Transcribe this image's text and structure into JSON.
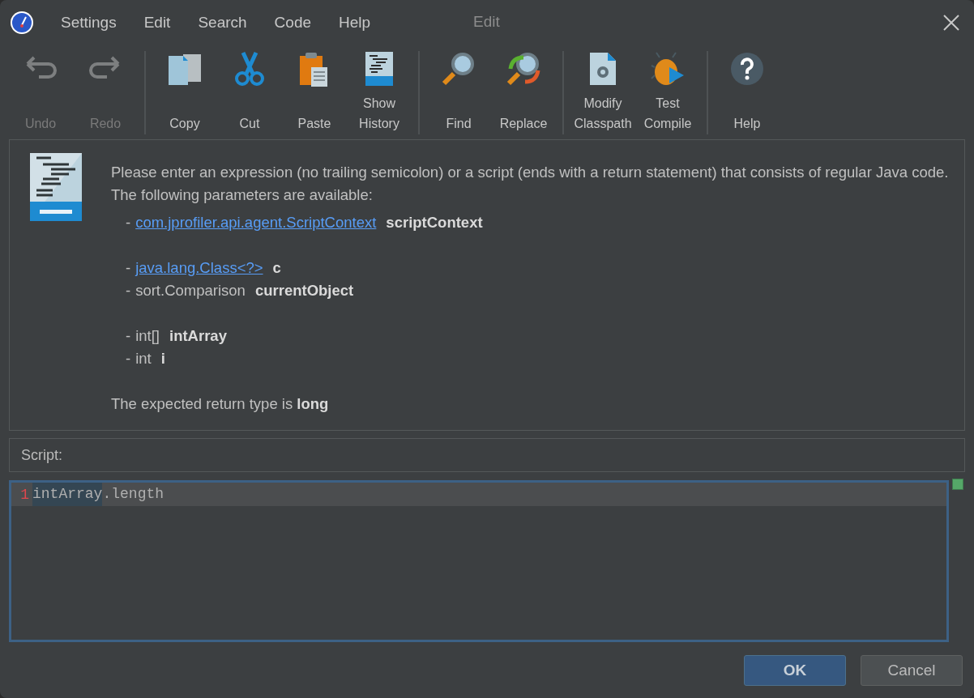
{
  "window": {
    "title": "Edit"
  },
  "menu": [
    "Settings",
    "Edit",
    "Search",
    "Code",
    "Help"
  ],
  "toolbar": [
    [
      {
        "kind": "undo",
        "lines": [
          "Undo"
        ],
        "disabled": true
      },
      {
        "kind": "redo",
        "lines": [
          "Redo"
        ],
        "disabled": true
      }
    ],
    [
      {
        "kind": "copy",
        "lines": [
          "Copy"
        ],
        "disabled": false
      },
      {
        "kind": "cut",
        "lines": [
          "Cut"
        ],
        "disabled": false
      },
      {
        "kind": "paste",
        "lines": [
          "Paste"
        ],
        "disabled": false
      },
      {
        "kind": "history",
        "lines": [
          "Show",
          "History"
        ],
        "disabled": false
      }
    ],
    [
      {
        "kind": "find",
        "lines": [
          "Find"
        ],
        "disabled": false
      },
      {
        "kind": "replace",
        "lines": [
          "Replace"
        ],
        "disabled": false
      }
    ],
    [
      {
        "kind": "classpath",
        "lines": [
          "Modify",
          "Classpath"
        ],
        "disabled": false
      },
      {
        "kind": "compile",
        "lines": [
          "Test",
          "Compile"
        ],
        "disabled": false
      }
    ],
    [
      {
        "kind": "help",
        "lines": [
          "Help"
        ],
        "disabled": false
      }
    ]
  ],
  "description": {
    "intro": "Please enter an expression (no trailing semicolon) or a script (ends with a return statement) that consists of regular Java code. The following parameters are available:",
    "parameter_groups": [
      [
        {
          "bullet": "-",
          "type": "com.jprofiler.api.agent.ScriptContext",
          "link": true,
          "name": "scriptContext"
        }
      ],
      [
        {
          "bullet": "-",
          "type": "java.lang.Class<?>",
          "link": true,
          "name": "c"
        },
        {
          "bullet": "-",
          "type": "sort.Comparison",
          "link": false,
          "name": "currentObject"
        }
      ],
      [
        {
          "bullet": "-",
          "type": "int[]",
          "link": false,
          "name": "intArray"
        },
        {
          "bullet": "-",
          "type": "int",
          "link": false,
          "name": "i"
        }
      ]
    ],
    "return_note": "The expected return type is **long**"
  },
  "script": {
    "label": "Script:",
    "lines": [
      {
        "number": "1",
        "current": true,
        "segments": [
          {
            "text": "intArray",
            "highlighted": true
          },
          {
            "text": ".length",
            "highlighted": false
          }
        ]
      }
    ]
  },
  "buttons": [
    {
      "label": "OK",
      "default": true
    },
    {
      "label": "Cancel",
      "default": false
    }
  ]
}
